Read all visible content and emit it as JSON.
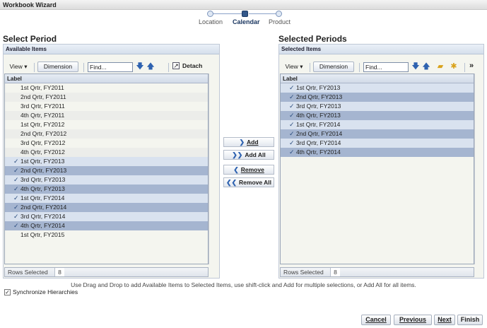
{
  "window": {
    "title": "Workbook Wizard"
  },
  "train": {
    "steps": [
      {
        "label": "Location"
      },
      {
        "label": "Calendar"
      },
      {
        "label": "Product"
      }
    ]
  },
  "left": {
    "title": "Select Period",
    "header": "Available Items",
    "view_label": "View",
    "dimension_label": "Dimension",
    "find_value": "Find...",
    "detach_label": "Detach",
    "column_label": "Label",
    "items": [
      {
        "label": "1st Qrtr, FY2011",
        "selected": false
      },
      {
        "label": "2nd Qrtr, FY2011",
        "selected": false
      },
      {
        "label": "3rd Qrtr, FY2011",
        "selected": false
      },
      {
        "label": "4th Qrtr, FY2011",
        "selected": false
      },
      {
        "label": "1st Qrtr, FY2012",
        "selected": false
      },
      {
        "label": "2nd Qrtr, FY2012",
        "selected": false
      },
      {
        "label": "3rd Qrtr, FY2012",
        "selected": false
      },
      {
        "label": "4th Qrtr, FY2012",
        "selected": false
      },
      {
        "label": "1st Qrtr, FY2013",
        "selected": true
      },
      {
        "label": "2nd Qrtr, FY2013",
        "selected": true
      },
      {
        "label": "3rd Qrtr, FY2013",
        "selected": true
      },
      {
        "label": "4th Qrtr, FY2013",
        "selected": true
      },
      {
        "label": "1st Qrtr, FY2014",
        "selected": true
      },
      {
        "label": "2nd Qrtr, FY2014",
        "selected": true
      },
      {
        "label": "3rd Qrtr, FY2014",
        "selected": true
      },
      {
        "label": "4th Qrtr, FY2014",
        "selected": true
      },
      {
        "label": "1st Qrtr, FY2015",
        "selected": false
      }
    ],
    "rows_selected_label": "Rows Selected",
    "rows_selected_count": "8"
  },
  "middle": {
    "add_label": "Add",
    "add_all_label": "Add All",
    "remove_label": "Remove",
    "remove_all_label": "Remove All"
  },
  "right": {
    "title": "Selected Periods",
    "header": "Selected Items",
    "view_label": "View",
    "dimension_label": "Dimension",
    "find_value": "Find...",
    "column_label": "Label",
    "items": [
      {
        "label": "1st Qrtr, FY2013",
        "selected": true
      },
      {
        "label": "2nd Qrtr, FY2013",
        "selected": true
      },
      {
        "label": "3rd Qrtr, FY2013",
        "selected": true
      },
      {
        "label": "4th Qrtr, FY2013",
        "selected": true
      },
      {
        "label": "1st Qrtr, FY2014",
        "selected": true
      },
      {
        "label": "2nd Qrtr, FY2014",
        "selected": true
      },
      {
        "label": "3rd Qrtr, FY2014",
        "selected": true
      },
      {
        "label": "4th Qrtr, FY2014",
        "selected": true
      }
    ],
    "rows_selected_label": "Rows Selected",
    "rows_selected_count": "8",
    "more_label": "»"
  },
  "hint": "Use Drag and Drop to add Available Items to Selected Items, use shift-click and Add for multiple selections, or Add All for all items.",
  "sync": {
    "label": "Synchronize Hierarchies",
    "checked": true
  },
  "footer": {
    "cancel": "Cancel",
    "previous": "Previous",
    "next": "Next",
    "finish": "Finish"
  },
  "icons": {
    "view_dropdown": "chevron-down-icon",
    "move_down": "arrow-down-icon",
    "move_up": "arrow-up-icon",
    "detach": "detach-icon",
    "check": "check-icon"
  },
  "colors": {
    "selected_dark": "#a5b5d0",
    "selected_light": "#d9e2ef",
    "accent": "#2e62b0"
  }
}
